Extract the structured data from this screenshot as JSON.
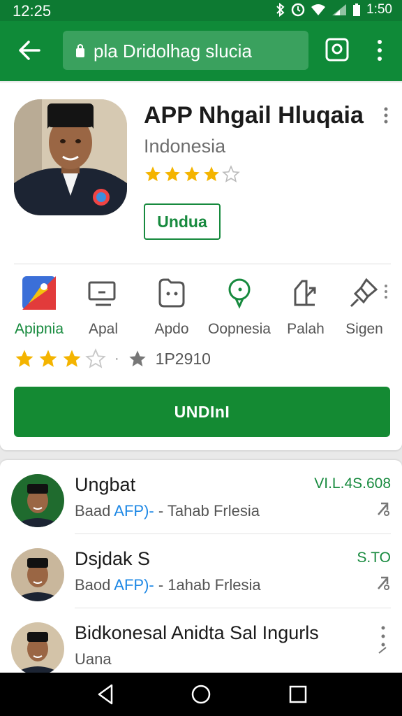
{
  "status_bar": {
    "time_left": "12:25",
    "time_right": "1:50"
  },
  "address_bar": {
    "url": "pla Dridolhag slucia"
  },
  "app": {
    "title": "APP Nhgail Hluqaia",
    "developer": "Indonesia",
    "rating_stars": 4,
    "install_outline_label": "Undua"
  },
  "categories": [
    {
      "label": "Apipnia",
      "icon": "app-logo-icon",
      "active": true
    },
    {
      "label": "Apal",
      "icon": "monitor-icon",
      "active": false
    },
    {
      "label": "Apdo",
      "icon": "tablet-icon",
      "active": false
    },
    {
      "label": "Oopnesia",
      "icon": "chat-bubble-icon",
      "active": false
    },
    {
      "label": "Palah",
      "icon": "share-doc-icon",
      "active": false
    },
    {
      "label": "Sigen",
      "icon": "pin-icon",
      "active": false
    }
  ],
  "rating_row": {
    "stars": 3,
    "count": "1P2910"
  },
  "install_button": {
    "label": "UNDInI"
  },
  "list_items": [
    {
      "title": "Ungbat",
      "sub_prefix": "Baad ",
      "sub_accent": "AFP)-",
      "sub_suffix": " - Tahab Frlesia",
      "price": "VI.L.4S.608",
      "action": "share-icon"
    },
    {
      "title": "Dsjdak  S",
      "sub_prefix": "Baod ",
      "sub_accent": "AFP)-",
      "sub_suffix": " - 1ahab Frlesia",
      "price": "S.TO",
      "action": "share-icon"
    },
    {
      "title": "Bidkonesal  Anidta  Sal  Ingurls",
      "sub_prefix": "Uana",
      "sub_accent": "",
      "sub_suffix": "",
      "price": "",
      "action": "more-icon"
    }
  ],
  "colors": {
    "green_dark": "#0d7a32",
    "green": "#148a33",
    "star": "#f4b400",
    "accent_blue": "#1e88e5"
  }
}
